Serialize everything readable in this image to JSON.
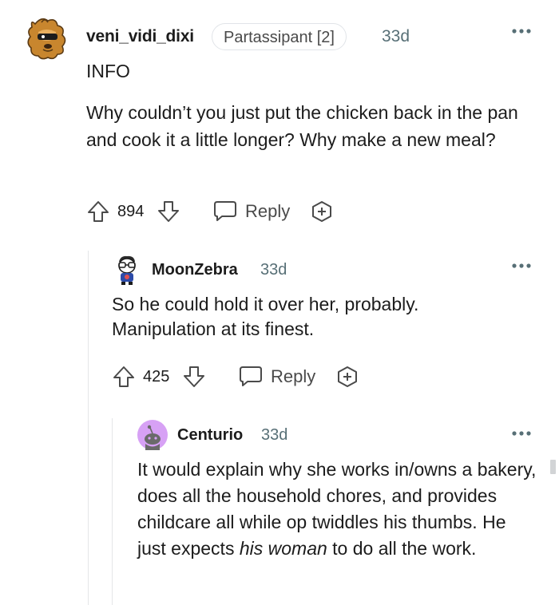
{
  "comments": [
    {
      "username": "veni_vidi_dixi",
      "flair": "Partassipant [2]",
      "time": "33d",
      "line1": "INFO",
      "body": "Why couldn’t you just put the chicken back in the pan and cook it a little longer? Why make a new meal?",
      "score": "894",
      "reply_label": "Reply"
    },
    {
      "username": "MoonZebra",
      "time": "33d",
      "body_line1": "So he could hold it over her, probably.",
      "body_line2": "Manipulation at its finest.",
      "score": "425",
      "reply_label": "Reply"
    },
    {
      "username": "Centurio",
      "time": "33d",
      "body_part1": "It would explain why she works in/owns a bakery, does all the household chores, and provides childcare all while op twiddles his thumbs. He just expects ",
      "body_italic1": "his woman",
      "body_part2": " to do all the work."
    }
  ],
  "icons": {
    "more": "more-options-icon",
    "upvote": "upvote-arrow-icon",
    "downvote": "downvote-arrow-icon",
    "reply": "speech-bubble-icon",
    "award": "award-plus-icon"
  },
  "colors": {
    "text": "#1c1c1c",
    "meta": "#576f76",
    "thread_line": "#e4e6e8",
    "centurio_avatar_bg": "#d7a1f5"
  }
}
